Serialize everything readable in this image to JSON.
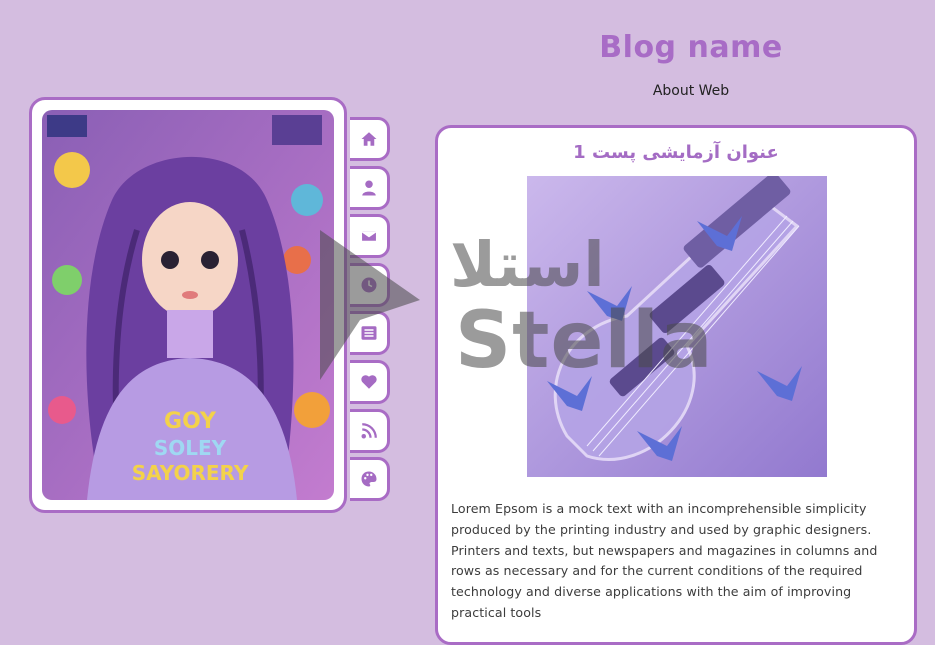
{
  "header": {
    "blog_name": "Blog name",
    "blog_description": "About Web"
  },
  "side_nav": {
    "items": [
      {
        "icon": "home-icon"
      },
      {
        "icon": "user-icon"
      },
      {
        "icon": "envelope-icon"
      },
      {
        "icon": "history-icon"
      },
      {
        "icon": "list-icon"
      },
      {
        "icon": "heart-icon"
      },
      {
        "icon": "rss-icon"
      },
      {
        "icon": "palette-icon"
      }
    ]
  },
  "post": {
    "title": "عنوان آزمایشی پست 1",
    "body": "Lorem Epsom is a mock text with an incomprehensible simplicity produced by the printing industry and used by graphic designers. Printers and texts, but newspapers and magazines in columns and rows as necessary and for the current conditions of the required technology and diverse applications with the aim of improving practical tools"
  },
  "watermark": {
    "arabic_text": "استلا",
    "latin_text": "Stella"
  },
  "colors": {
    "background": "#d4bde0",
    "accent": "#a96cc5",
    "card": "#ffffff"
  }
}
